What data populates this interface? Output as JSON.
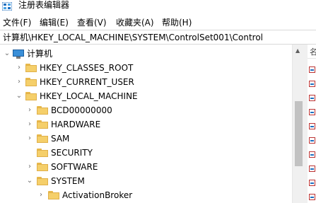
{
  "window": {
    "title": "注册表编辑器",
    "app_icon": "registry-editor-icon"
  },
  "menu": [
    {
      "label": "文件(F)"
    },
    {
      "label": "编辑(E)"
    },
    {
      "label": "查看(V)"
    },
    {
      "label": "收藏夹(A)"
    },
    {
      "label": "帮助(H)"
    }
  ],
  "address": {
    "path": "计算机\\HKEY_LOCAL_MACHINE\\SYSTEM\\ControlSet001\\Control"
  },
  "tree": {
    "root": {
      "label": "计算机",
      "icon": "computer-icon",
      "expanded": true
    },
    "nodes": [
      {
        "label": "HKEY_CLASSES_ROOT",
        "expanded": false
      },
      {
        "label": "HKEY_CURRENT_USER",
        "expanded": false
      },
      {
        "label": "HKEY_LOCAL_MACHINE",
        "expanded": true
      },
      {
        "label": "BCD00000000",
        "expanded": false
      },
      {
        "label": "HARDWARE",
        "expanded": false
      },
      {
        "label": "SAM",
        "expanded": false
      },
      {
        "label": "SECURITY",
        "expanded": false
      },
      {
        "label": "SOFTWARE",
        "expanded": false
      },
      {
        "label": "SYSTEM",
        "expanded": true
      },
      {
        "label": "ActivationBroker",
        "expanded": false
      }
    ]
  },
  "values_pane": {
    "header_fragment": "名"
  },
  "colors": {
    "folder": "#f5cf6a",
    "folder_border": "#e0b04a",
    "computer_screen": "#3a8fd8",
    "scrollbar_thumb": "#c2c2c2"
  }
}
